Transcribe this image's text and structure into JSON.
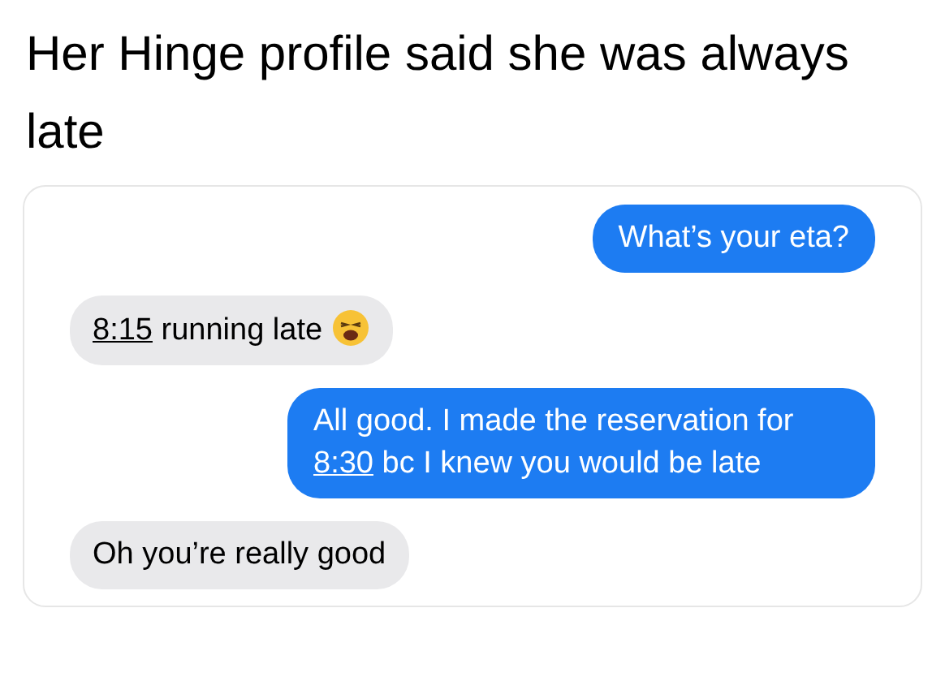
{
  "caption": "Her Hinge profile said she was always late",
  "messages": [
    {
      "outgoing": true,
      "parts": [
        {
          "kind": "text",
          "text": "What’s your eta?"
        }
      ]
    },
    {
      "outgoing": false,
      "parts": [
        {
          "kind": "link",
          "text": "8:15"
        },
        {
          "kind": "text",
          "text": " running late "
        },
        {
          "kind": "emoji"
        }
      ]
    },
    {
      "outgoing": true,
      "parts": [
        {
          "kind": "text",
          "text": "All good. I made the reservation for "
        },
        {
          "kind": "link",
          "text": "8:30"
        },
        {
          "kind": "text",
          "text": " bc I knew you would be late"
        }
      ]
    },
    {
      "outgoing": false,
      "parts": [
        {
          "kind": "text",
          "text": "Oh you’re really good"
        }
      ]
    }
  ]
}
